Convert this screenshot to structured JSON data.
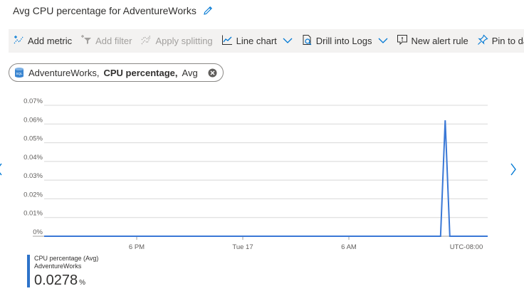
{
  "header": {
    "title": "Avg CPU percentage for AdventureWorks"
  },
  "toolbar": {
    "add_metric": "Add metric",
    "add_filter": "Add filter",
    "apply_splitting": "Apply splitting",
    "line_chart": "Line chart",
    "drill_into_logs": "Drill into Logs",
    "new_alert_rule": "New alert rule",
    "pin_to_dashboard": "Pin to dashbo"
  },
  "pill": {
    "resource": "AdventureWorks,",
    "metric": "CPU percentage,",
    "aggregation": "Avg"
  },
  "chart_data": {
    "type": "line",
    "title": "",
    "xlabel": "",
    "ylabel": "",
    "y_ticks": [
      "0.07%",
      "0.06%",
      "0.05%",
      "0.04%",
      "0.03%",
      "0.02%",
      "0.01%",
      "0%"
    ],
    "ylim": [
      0,
      0.07
    ],
    "x_ticks": [
      "6 PM",
      "Tue 17",
      "6 AM",
      "UTC-08:00"
    ],
    "xlim": [
      0,
      24
    ],
    "grid": true,
    "colors": {
      "series": "#3a78d6",
      "grid": "#d8d8d8",
      "axis": "#a0a0a0"
    },
    "series": [
      {
        "name": "CPU percentage (Avg)",
        "points": [
          [
            0,
            0
          ],
          [
            21.45,
            0
          ],
          [
            21.7,
            0.062
          ],
          [
            21.95,
            0
          ],
          [
            24,
            0
          ]
        ]
      }
    ]
  },
  "legend": {
    "metric": "CPU percentage (Avg)",
    "resource": "AdventureWorks",
    "value": "0.0278",
    "unit": "%"
  }
}
